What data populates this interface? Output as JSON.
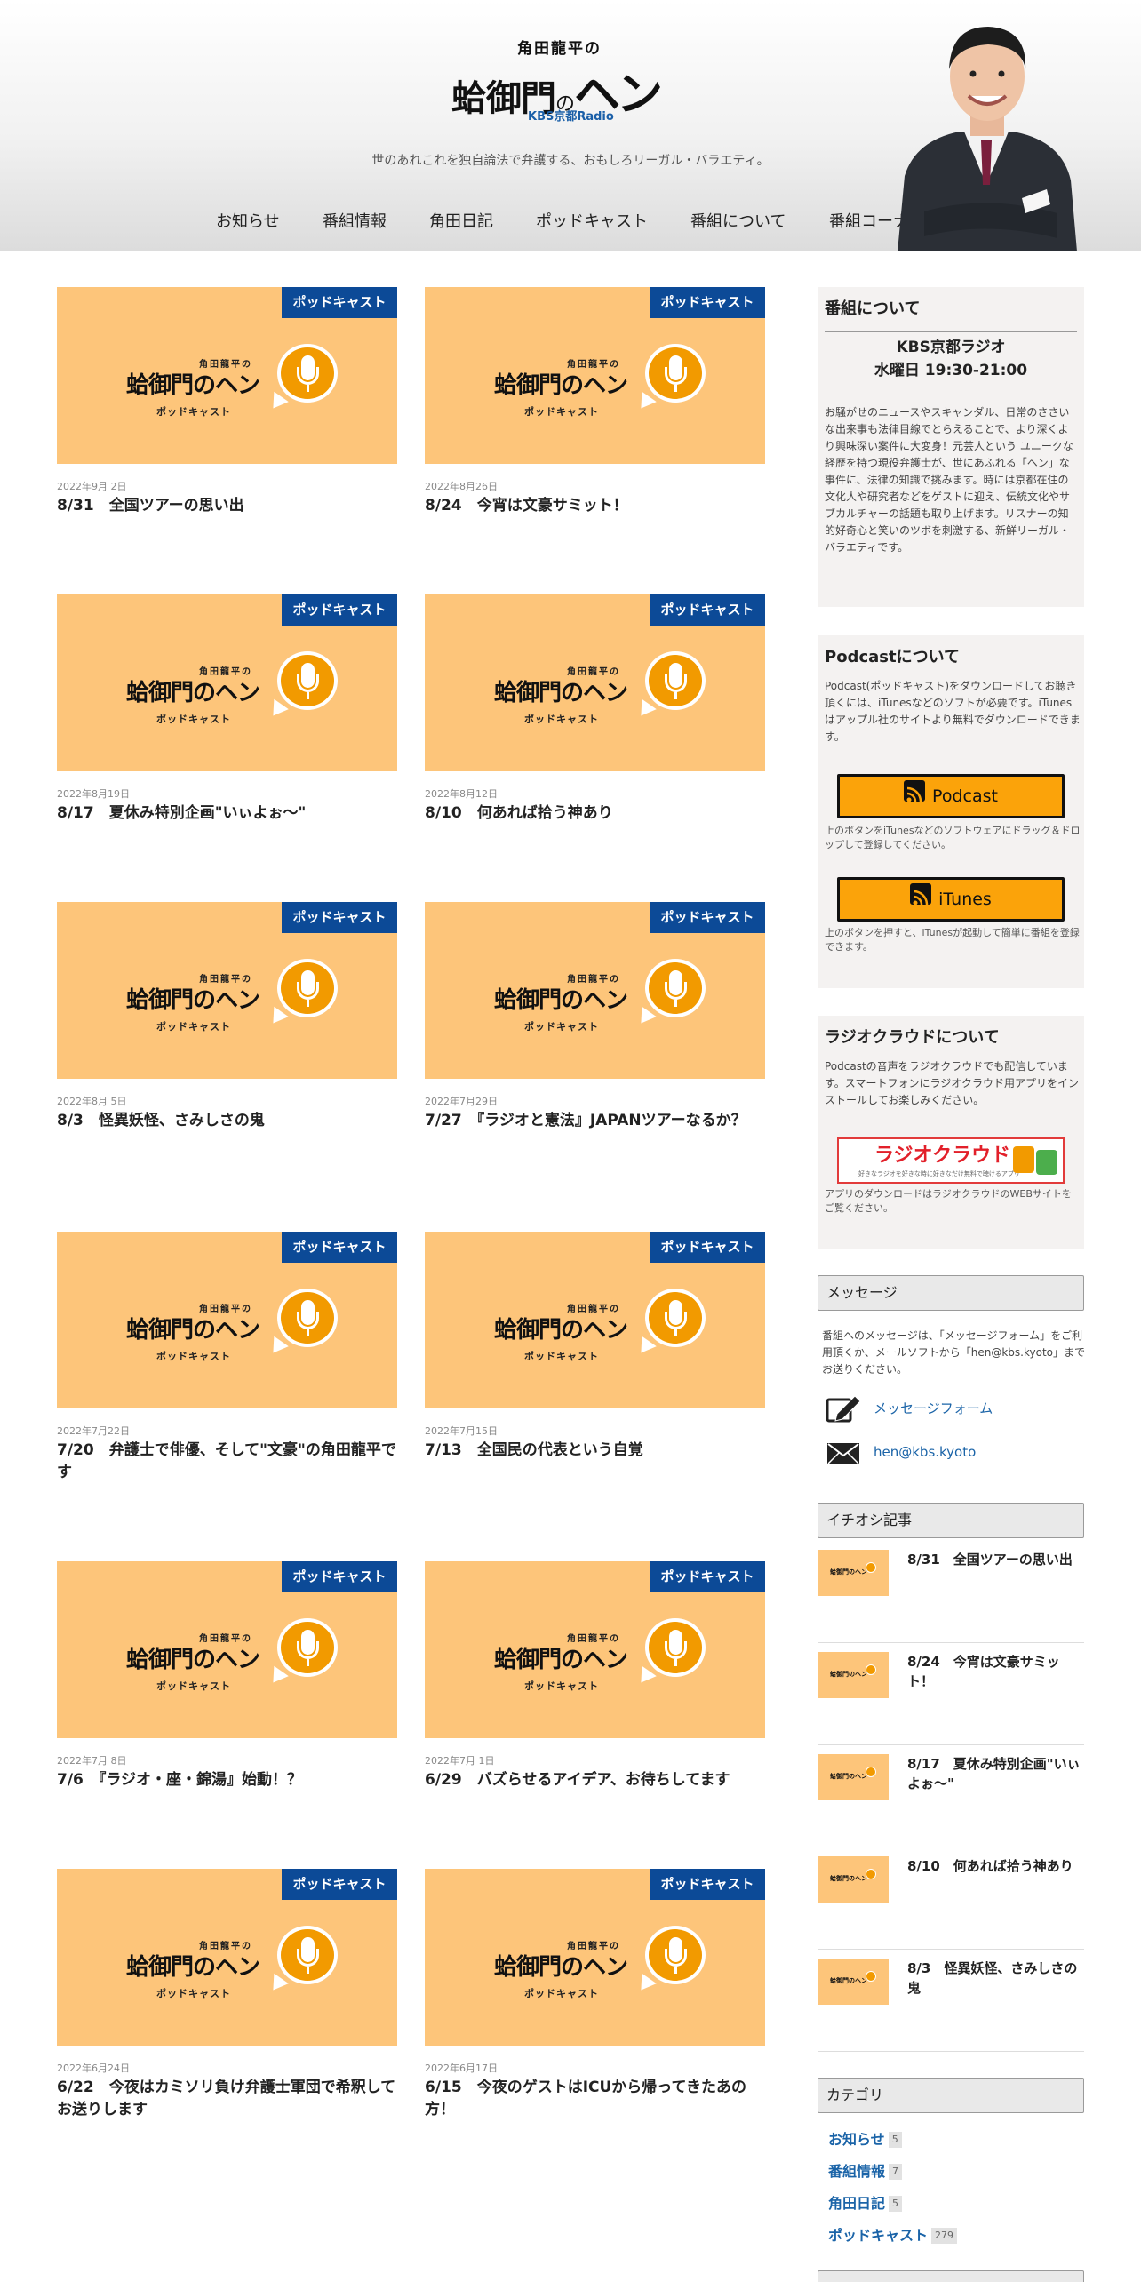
{
  "header": {
    "logo_top": "角田龍平の",
    "logo_main_a": "蛤御門",
    "logo_main_no": "の",
    "logo_main_hen": "ヘン",
    "logo_station": "KBS京都Radio",
    "tagline": "世のあれこれを独自論法で弁護する、おもしろリーガル・バラエティ。"
  },
  "nav": [
    {
      "label": "お知らせ"
    },
    {
      "label": "番組情報"
    },
    {
      "label": "角田日記"
    },
    {
      "label": "ポッドキャスト"
    },
    {
      "label": "番組について"
    },
    {
      "label": "番組コーナー"
    }
  ],
  "thumb": {
    "badge": "ポッドキャスト",
    "small": "角田龍平の",
    "main": "蛤御門のヘン",
    "sub": "ポッドキャスト"
  },
  "posts": [
    {
      "date": "2022年9月 2日",
      "title": "8/31　全国ツアーの思い出"
    },
    {
      "date": "2022年8月26日",
      "title": "8/24　今宵は文豪サミット！"
    },
    {
      "date": "2022年8月19日",
      "title": "8/17　夏休み特別企画\"いぃよぉ～\""
    },
    {
      "date": "2022年8月12日",
      "title": "8/10　何あれば拾う神あり"
    },
    {
      "date": "2022年8月 5日",
      "title": "8/3　怪異妖怪、さみしさの鬼"
    },
    {
      "date": "2022年7月29日",
      "title": "7/27　『ラジオと憲法』JAPANツアーなるか？"
    },
    {
      "date": "2022年7月22日",
      "title": "7/20　弁護士で俳優、そして\"文豪\"の角田龍平です"
    },
    {
      "date": "2022年7月15日",
      "title": "7/13　全国民の代表という自覚"
    },
    {
      "date": "2022年7月 8日",
      "title": "7/6　『ラジオ・座・錦湯』始動！？"
    },
    {
      "date": "2022年7月 1日",
      "title": "6/29　バズらせるアイデア、お待ちしてます"
    },
    {
      "date": "2022年6月24日",
      "title": "6/22　今夜はカミソリ負け弁護士軍団で希釈してお送りします"
    },
    {
      "date": "2022年6月17日",
      "title": "6/15　今夜のゲストはICUから帰ってきたあの方！"
    }
  ],
  "sidebar": {
    "about": {
      "title": "番組について",
      "station": "KBS京都ラジオ",
      "time": "水曜日 19:30-21:00",
      "text": "お騒がせのニュースやスキャンダル、日常のささいな出来事も法律目線でとらえることで、より深くより興味深い案件に大変身！元芸人という ユニークな経歴を持つ現役弁護士が、世にあふれる「ヘン」な事件に、法律の知識で挑みます。時には京都在住の文化人や研究者などをゲストに迎え、伝統文化やサブカルチャーの話題も取り上げます。リスナーの知的好奇心と笑いのツボを刺激する、新鮮リーガル・バラエティです。"
    },
    "podcast": {
      "title": "Podcastについて",
      "text": "Podcast(ポッドキャスト)をダウンロードしてお聴き頂くには、iTunesなどのソフトが必要です。iTunesはアップル社のサイトより無料でダウンロードできます。",
      "btn1": "Podcast",
      "note1": "上のボタンをiTunesなどのソフトウェアにドラッグ＆ドロップして登録してください。",
      "btn2": "iTunes",
      "note2": "上のボタンを押すと、iTunesが起動して簡単に番組を登録できます。"
    },
    "radiocloud": {
      "title": "ラジオクラウドについて",
      "text": "Podcastの音声をラジオクラウドでも配信しています。スマートフォンにラジオクラウド用アプリをインストールしてお楽しみください。",
      "banner": "ラジオクラウド",
      "banner_sub": "好きなラジオを好きな時に好きなだけ無料で聴けるアプリ",
      "note": "アプリのダウンロードはラジオクラウドのWEBサイトをご覧ください。"
    },
    "message": {
      "title": "メッセージ",
      "text": "番組へのメッセージは、「メッセージフォーム」をご利用頂くか、メールソフトから「hen@kbs.kyoto」までお送りください。",
      "form_link": "メッセージフォーム",
      "email_link": "hen@kbs.kyoto"
    },
    "picks_title": "イチオシ記事",
    "picks": [
      {
        "title": "8/31　全国ツアーの思い出"
      },
      {
        "title": "8/24　今宵は文豪サミット！"
      },
      {
        "title": "8/17　夏休み特別企画\"いぃよぉ～\""
      },
      {
        "title": "8/10　何あれば拾う神あり"
      },
      {
        "title": "8/3　怪異妖怪、さみしさの鬼"
      }
    ],
    "category_title": "カテゴリ",
    "categories": [
      {
        "label": "お知らせ",
        "count": "5"
      },
      {
        "label": "番組情報",
        "count": "7"
      },
      {
        "label": "角田日記",
        "count": "5"
      },
      {
        "label": "ポッドキャスト",
        "count": "279"
      }
    ]
  },
  "colors": {
    "badge": "#0c4a97",
    "thumb_bg": "#fdc57a",
    "mic": "#f29a00",
    "button": "#fba30a",
    "link": "#1b64a8"
  }
}
